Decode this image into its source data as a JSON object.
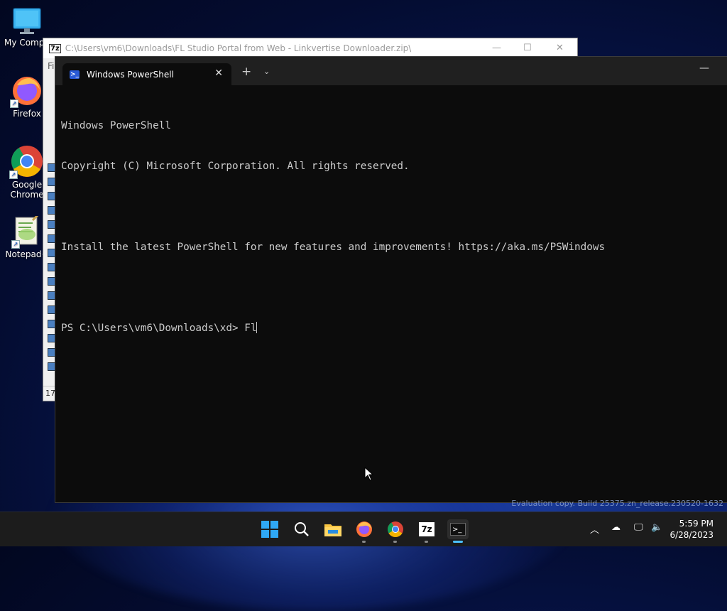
{
  "desktop": {
    "icons": [
      {
        "label": "My Compu",
        "icon": "computer-icon"
      },
      {
        "label": "Firefox",
        "icon": "firefox-icon"
      },
      {
        "label": "Google Chrome",
        "icon": "chrome-icon"
      },
      {
        "label": "Notepad+",
        "icon": "notepadpp-icon"
      }
    ],
    "watermark": "Evaluation copy. Build 25375.zn_release.230520-1632"
  },
  "background_window": {
    "title": "C:\\Users\\vm6\\Downloads\\FL Studio Portal from Web - Linkvertise Downloader.zip\\",
    "menu_fragment": "Fi",
    "status_fragment": "17"
  },
  "terminal": {
    "tab_title": "Windows PowerShell",
    "lines": [
      "Windows PowerShell",
      "Copyright (C) Microsoft Corporation. All rights reserved.",
      "",
      "Install the latest PowerShell for new features and improvements! https://aka.ms/PSWindows",
      ""
    ],
    "prompt": "PS C:\\Users\\vm6\\Downloads\\xd> ",
    "input": "Fl"
  },
  "taskbar": {
    "apps": [
      "start-icon",
      "search-icon",
      "file-explorer-icon",
      "firefox-icon",
      "chrome-icon",
      "7zip-icon",
      "terminal-icon"
    ],
    "active_app": "terminal-icon",
    "clock": {
      "time": "5:59 PM",
      "date": "6/28/2023"
    }
  },
  "colors": {
    "terminal_bg": "#0c0c0c",
    "tabbar_bg": "#202020",
    "accent": "#4cc2ff"
  }
}
